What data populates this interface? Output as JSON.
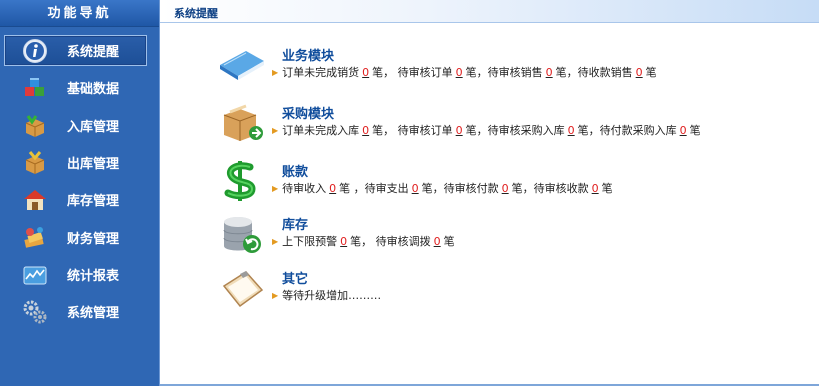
{
  "sidebar": {
    "header": "功能导航",
    "items": [
      {
        "label": "系统提醒",
        "icon": "info-icon"
      },
      {
        "label": "基础数据",
        "icon": "cubes-icon"
      },
      {
        "label": "入库管理",
        "icon": "box-in-icon"
      },
      {
        "label": "出库管理",
        "icon": "box-out-icon"
      },
      {
        "label": "库存管理",
        "icon": "warehouse-icon"
      },
      {
        "label": "财务管理",
        "icon": "money-icon"
      },
      {
        "label": "统计报表",
        "icon": "chart-icon"
      },
      {
        "label": "系统管理",
        "icon": "gears-icon"
      }
    ]
  },
  "main": {
    "title": "系统提醒",
    "modules": [
      {
        "title": "业务模块",
        "icon": "book-icon",
        "line": [
          {
            "t": "订单未完成销货"
          },
          {
            "n": "0"
          },
          {
            "t": "笔，  待审核订单"
          },
          {
            "n": "0"
          },
          {
            "t": "笔，待审核销售"
          },
          {
            "n": "0"
          },
          {
            "t": "笔，待收款销售"
          },
          {
            "n": "0"
          },
          {
            "t": "笔"
          }
        ]
      },
      {
        "title": "采购模块",
        "icon": "purchase-box-icon",
        "line": [
          {
            "t": "订单未完成入库"
          },
          {
            "n": "0"
          },
          {
            "t": "笔，  待审核订单"
          },
          {
            "n": "0"
          },
          {
            "t": "笔，待审核采购入库"
          },
          {
            "n": "0"
          },
          {
            "t": "笔，待付款采购入库"
          },
          {
            "n": "0"
          },
          {
            "t": "笔"
          }
        ]
      },
      {
        "title": "账款",
        "icon": "dollar-icon",
        "line": [
          {
            "t": "待审收入"
          },
          {
            "n": "0"
          },
          {
            "t": "笔 ，待审支出"
          },
          {
            "n": "0"
          },
          {
            "t": "笔，待审核付款"
          },
          {
            "n": "0"
          },
          {
            "t": "笔，待审核收款"
          },
          {
            "n": "0"
          },
          {
            "t": "笔"
          }
        ]
      },
      {
        "title": "库存",
        "icon": "database-icon",
        "line": [
          {
            "t": "上下限预警"
          },
          {
            "n": "0"
          },
          {
            "t": "笔，  待审核调拨"
          },
          {
            "n": "0"
          },
          {
            "t": "笔"
          }
        ]
      },
      {
        "title": "其它",
        "icon": "clipboard-icon",
        "line": [
          {
            "t": "等待升级增加………"
          }
        ]
      }
    ]
  },
  "colors": {
    "sidebar_bg": "#2f67b4",
    "accent_title": "#104d9c",
    "count_red": "#e02020",
    "bullet_orange": "#e39a21"
  }
}
